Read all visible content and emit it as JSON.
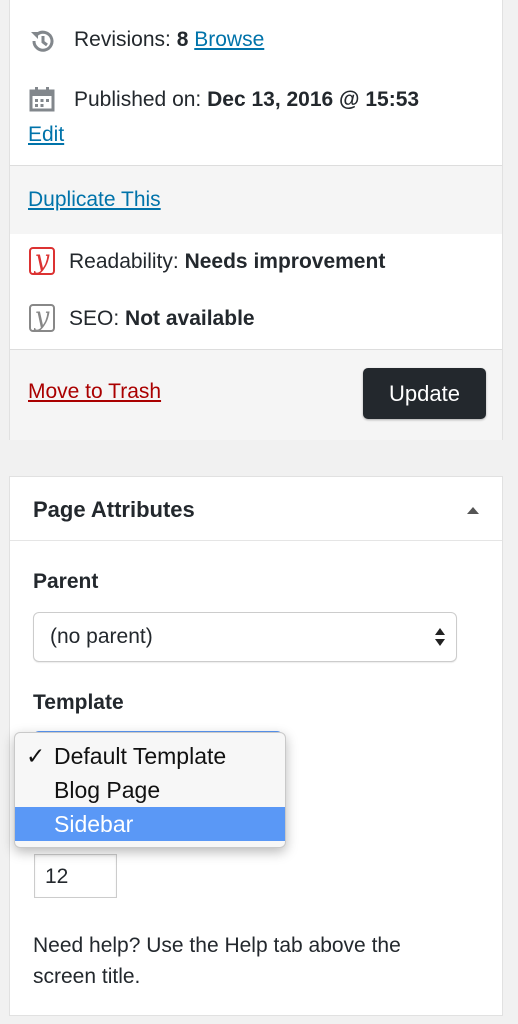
{
  "publish": {
    "revisions_label": "Revisions:",
    "revisions_count": "8",
    "browse_link": "Browse",
    "published_label": "Published on:",
    "published_date": "Dec 13, 2016 @ 15:53",
    "edit_link": "Edit",
    "duplicate_link": "Duplicate This",
    "readability_label": "Readability:",
    "readability_value": "Needs improvement",
    "readability_color": "#dc3232",
    "seo_label": "SEO:",
    "seo_value": "Not available",
    "seo_color": "#888888",
    "trash_link": "Move to Trash",
    "update_button": "Update"
  },
  "page_attributes": {
    "title": "Page Attributes",
    "parent_label": "Parent",
    "parent_value": "(no parent)",
    "template_label": "Template",
    "template_options": [
      {
        "label": "Default Template",
        "checked": true,
        "highlighted": false
      },
      {
        "label": "Blog Page",
        "checked": false,
        "highlighted": false
      },
      {
        "label": "Sidebar",
        "checked": false,
        "highlighted": true
      }
    ],
    "order_value": "12",
    "help_line1": "Need help? Use the Help tab above the",
    "help_line2": "screen title."
  },
  "colors": {
    "link": "#0073aa",
    "trash": "#aa0000",
    "update_button_bg": "#23282d",
    "dropdown_highlight": "#5a98f6"
  }
}
